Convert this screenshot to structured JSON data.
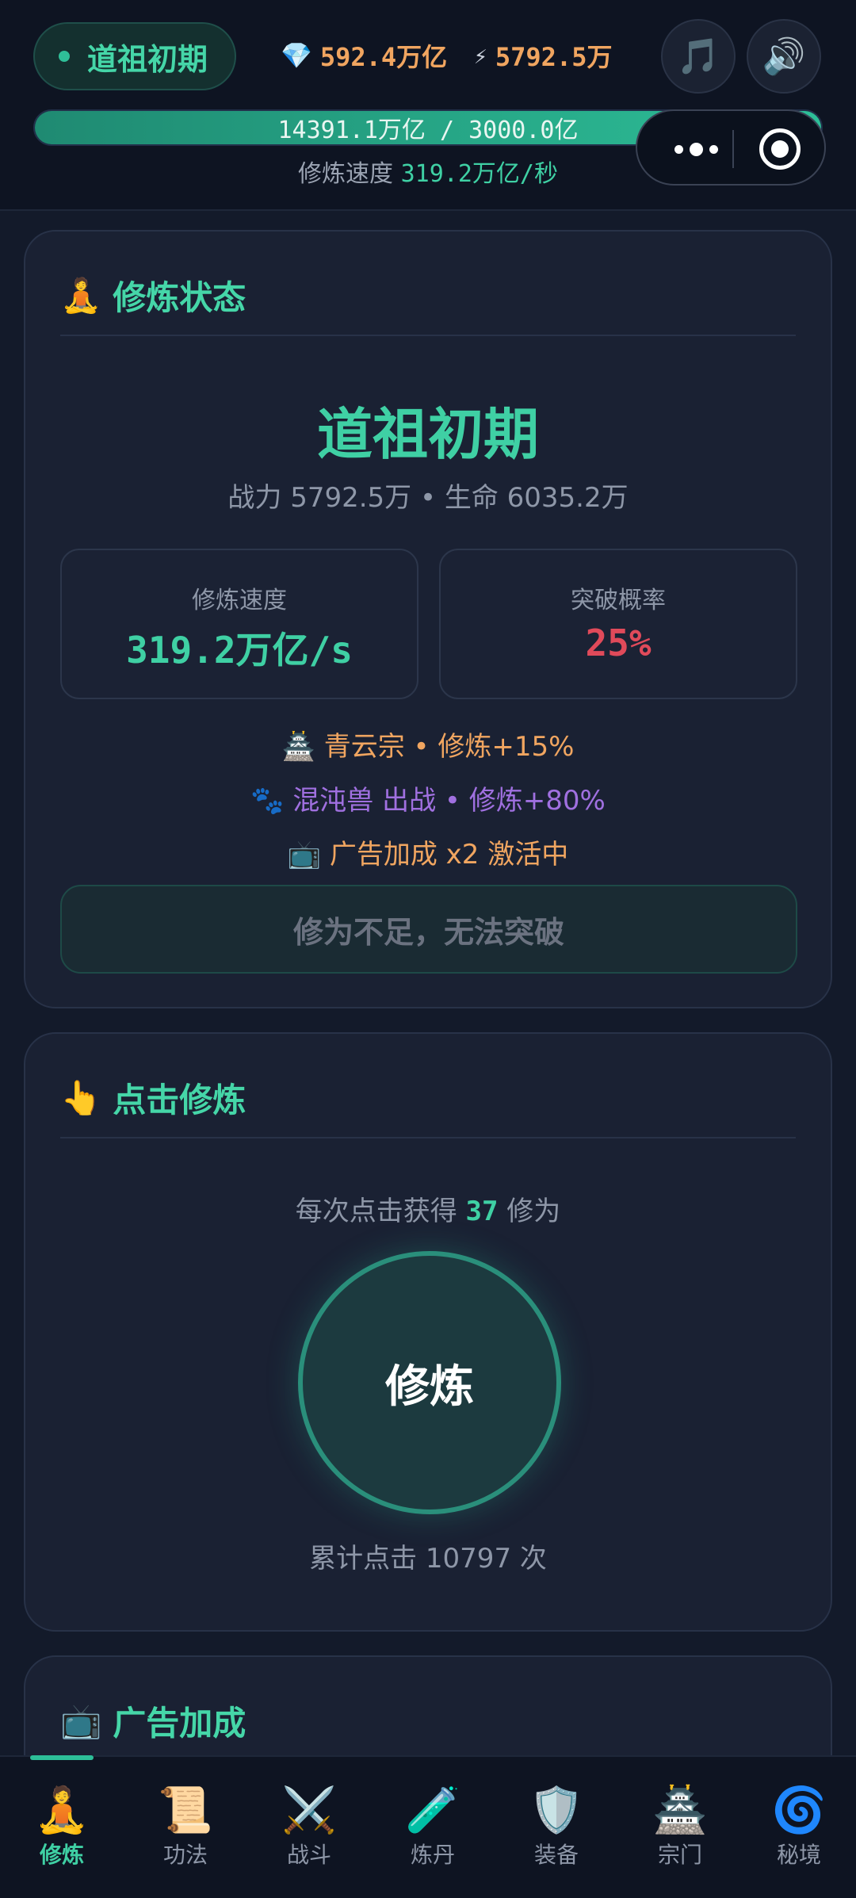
{
  "header": {
    "realm": "道祖初期",
    "spirit_stones": "592.4万亿",
    "power": "5792.5万",
    "music_icon": "🎵",
    "sound_icon": "🔊",
    "progress_text": "14391.1万亿 / 3000.0亿",
    "progress_fraction": 1.0,
    "speed_label": "修炼速度",
    "speed_value": "319.2万亿/秒"
  },
  "cultivation_status": {
    "icon": "🧘",
    "title": "修炼状态",
    "realm": "道祖初期",
    "combat_power_line": "战力 5792.5万 • 生命 6035.2万",
    "speed_label": "修炼速度",
    "speed_value": "319.2万亿/s",
    "breakthrough_label": "突破概率",
    "breakthrough_value": "25%",
    "sect_bonus": "🏯 青云宗 • 修炼+15%",
    "pet_bonus": "🐾 混沌兽 出战 • 修炼+80%",
    "ad_bonus": "📺 广告加成 x2 激活中",
    "breakthrough_button": "修为不足，无法突破"
  },
  "click_cultivation": {
    "icon": "👆",
    "title": "点击修炼",
    "gain_prefix": "每次点击获得",
    "gain_value": "37",
    "gain_suffix": "修为",
    "button_label": "修炼",
    "total_clicks": "累计点击 10797 次"
  },
  "ad_bonus_card": {
    "icon": "📺",
    "title": "广告加成"
  },
  "nav": [
    {
      "icon": "🧘",
      "label": "修炼",
      "active": true
    },
    {
      "icon": "📜",
      "label": "功法"
    },
    {
      "icon": "⚔️",
      "label": "战斗"
    },
    {
      "icon": "🧪",
      "label": "炼丹"
    },
    {
      "icon": "🛡️",
      "label": "装备"
    },
    {
      "icon": "🏯",
      "label": "宗门"
    },
    {
      "icon": "🌀",
      "label": "秘境"
    }
  ],
  "colors": {
    "accent": "#3fd0a4",
    "resource": "#f0a560",
    "danger": "#e04a5a",
    "pet": "#a070e0",
    "background": "#131a2a"
  }
}
